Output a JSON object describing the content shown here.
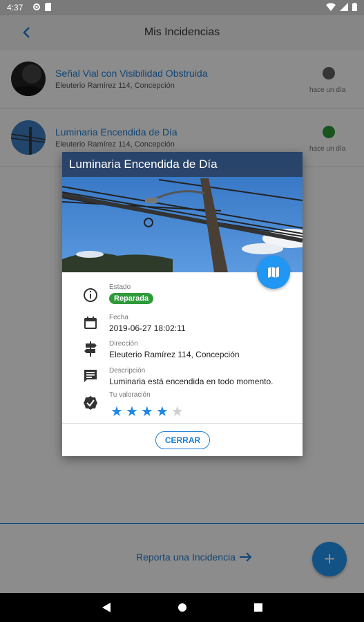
{
  "status_bar": {
    "time": "4:37"
  },
  "app_bar": {
    "title": "Mis Incidencias"
  },
  "incidents": [
    {
      "title": "Señal Vial con Visibilidad Obstruida",
      "address": "Eleuterio Ramírez 114, Concepción",
      "time_ago": "hace un día",
      "status_color": "#616161"
    },
    {
      "title": "Luminaria Encendida de Día",
      "address": "Eleuterio Ramírez 114, Concepción",
      "time_ago": "hace un día",
      "status_color": "#2e9a3a"
    }
  ],
  "footer": {
    "report_label": "Reporta una Incidencia",
    "fab_label": "+"
  },
  "modal": {
    "title": "Luminaria Encendida de Día",
    "estado_label": "Estado",
    "estado_value": "Reparada",
    "fecha_label": "Fecha",
    "fecha_value": "2019-06-27 18:02:11",
    "direccion_label": "Dirección",
    "direccion_value": "Eleuterio Ramírez 114, Concepción",
    "descripcion_label": "Descripción",
    "descripcion_value": "Luminaria está encendida en todo momento.",
    "valoracion_label": "Tu valoración",
    "rating": 4,
    "rating_max": 5,
    "close_label": "CERRAR"
  },
  "colors": {
    "accent": "#2196f3",
    "link": "#1e7fd6",
    "status_ok": "#2e9a3a",
    "star_on": "#1e88e5",
    "star_off": "#cfcfcf"
  },
  "icons": [
    "back-arrow-icon",
    "settings-icon",
    "battery-icon",
    "wifi-icon",
    "signal-icon",
    "map-icon",
    "info-icon",
    "calendar-icon",
    "signpost-icon",
    "description-icon",
    "verified-icon",
    "star-icon",
    "arrow-right-icon",
    "plus-icon",
    "nav-back-icon",
    "nav-home-icon",
    "nav-recents-icon"
  ]
}
